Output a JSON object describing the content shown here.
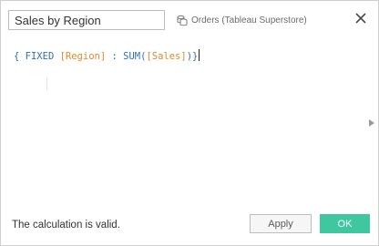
{
  "dialog": {
    "calc_name": "Sales by Region",
    "datasource_label": "Orders (Tableau Superstore)",
    "icons": {
      "datasource": "datasource-icon",
      "close": "close-icon",
      "expand": "expand-arrow-icon"
    }
  },
  "editor": {
    "tokens": {
      "open_brace": "{",
      "keyword": "FIXED",
      "dimension": "[Region]",
      "colon": ":",
      "function": "SUM(",
      "measure": "[Sales]",
      "close_paren": ")",
      "close_brace": "}"
    },
    "colors": {
      "keyword": "#2f6fb0",
      "field": "#e08a2a"
    }
  },
  "footer": {
    "status_text": "The calculation is valid.",
    "apply_label": "Apply",
    "ok_label": "OK",
    "ok_color": "#3fc7a0"
  }
}
